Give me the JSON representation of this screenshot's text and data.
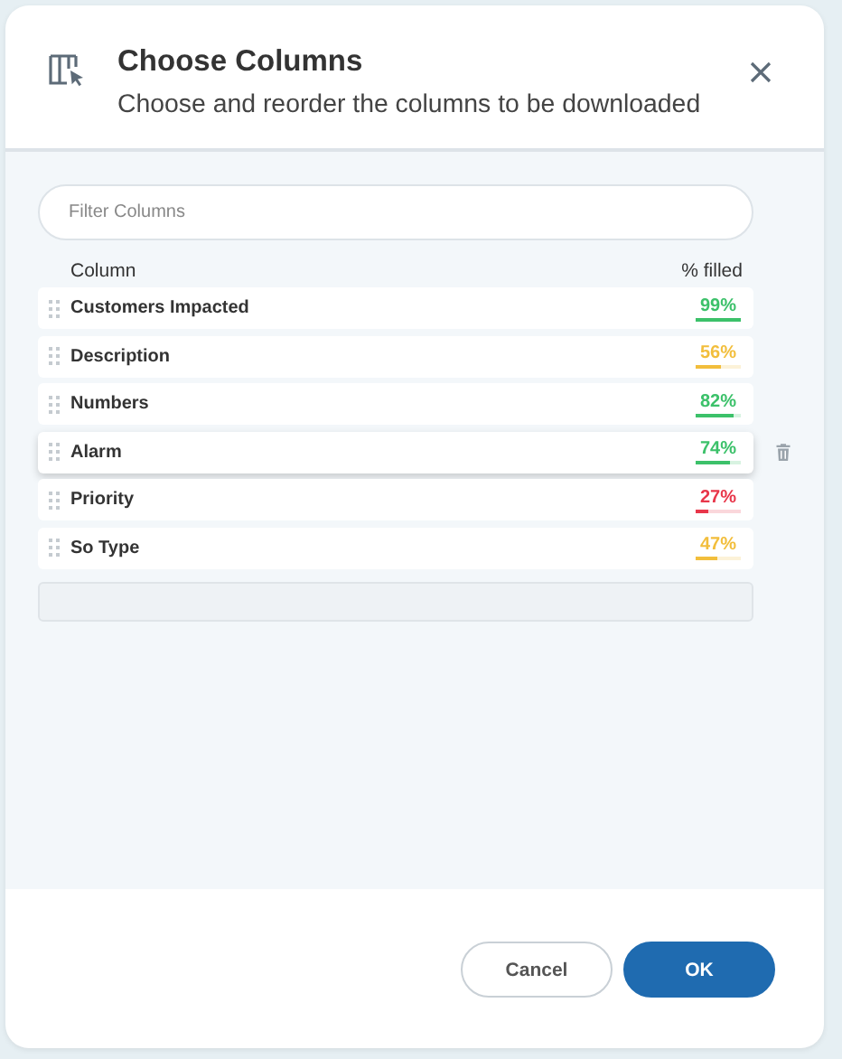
{
  "dialog": {
    "title": "Choose Columns",
    "subtitle": "Choose and reorder the columns to be downloaded"
  },
  "filter": {
    "placeholder": "Filter Columns"
  },
  "table": {
    "columns": [
      "Column",
      "% filled"
    ],
    "rows": [
      {
        "name": "Customers Impacted",
        "reading": "99%",
        "level": 0.99,
        "color": "#3cc16a",
        "hovered": false
      },
      {
        "name": "Description",
        "reading": "56%",
        "level": 0.56,
        "color": "#f2be3c",
        "hovered": false
      },
      {
        "name": "Numbers",
        "reading": "82%",
        "level": 0.82,
        "color": "#3cc16a",
        "hovered": false
      },
      {
        "name": "Alarm",
        "reading": "74%",
        "level": 0.74,
        "color": "#3cc16a",
        "hovered": true
      },
      {
        "name": "Priority",
        "reading": "27%",
        "level": 0.27,
        "color": "#e8364a",
        "hovered": false
      },
      {
        "name": "So Type",
        "reading": "47%",
        "level": 0.47,
        "color": "#f2be3c",
        "hovered": false
      }
    ]
  },
  "buttons": [
    {
      "label": "Cancel",
      "kind": "secondary"
    },
    {
      "label": "OK",
      "kind": "primary"
    }
  ]
}
